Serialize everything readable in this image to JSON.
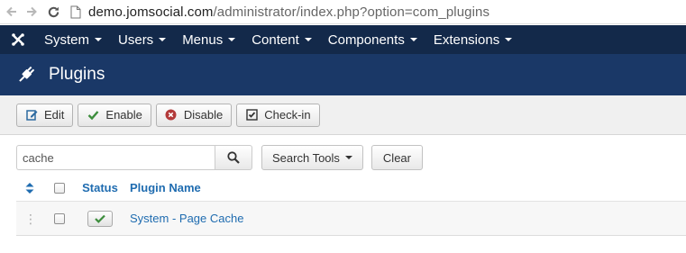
{
  "browser": {
    "url_host": "demo.jomsocial.com",
    "url_path": "/administrator/index.php?option=com_plugins"
  },
  "navbar": {
    "items": [
      {
        "label": "System"
      },
      {
        "label": "Users"
      },
      {
        "label": "Menus"
      },
      {
        "label": "Content"
      },
      {
        "label": "Components"
      },
      {
        "label": "Extensions"
      }
    ]
  },
  "header": {
    "title": "Plugins"
  },
  "toolbar": {
    "edit_label": "Edit",
    "enable_label": "Enable",
    "disable_label": "Disable",
    "checkin_label": "Check-in"
  },
  "search": {
    "value": "cache",
    "tools_label": "Search Tools",
    "clear_label": "Clear"
  },
  "table": {
    "headers": {
      "status": "Status",
      "name": "Plugin Name"
    },
    "rows": [
      {
        "name": "System - Page Cache",
        "enabled": true
      }
    ]
  },
  "colors": {
    "navbar": "#13294a",
    "header": "#1a3867",
    "link": "#1f6cb0",
    "enabled_check": "#3c8d3c",
    "disable_icon": "#b33a3a"
  }
}
